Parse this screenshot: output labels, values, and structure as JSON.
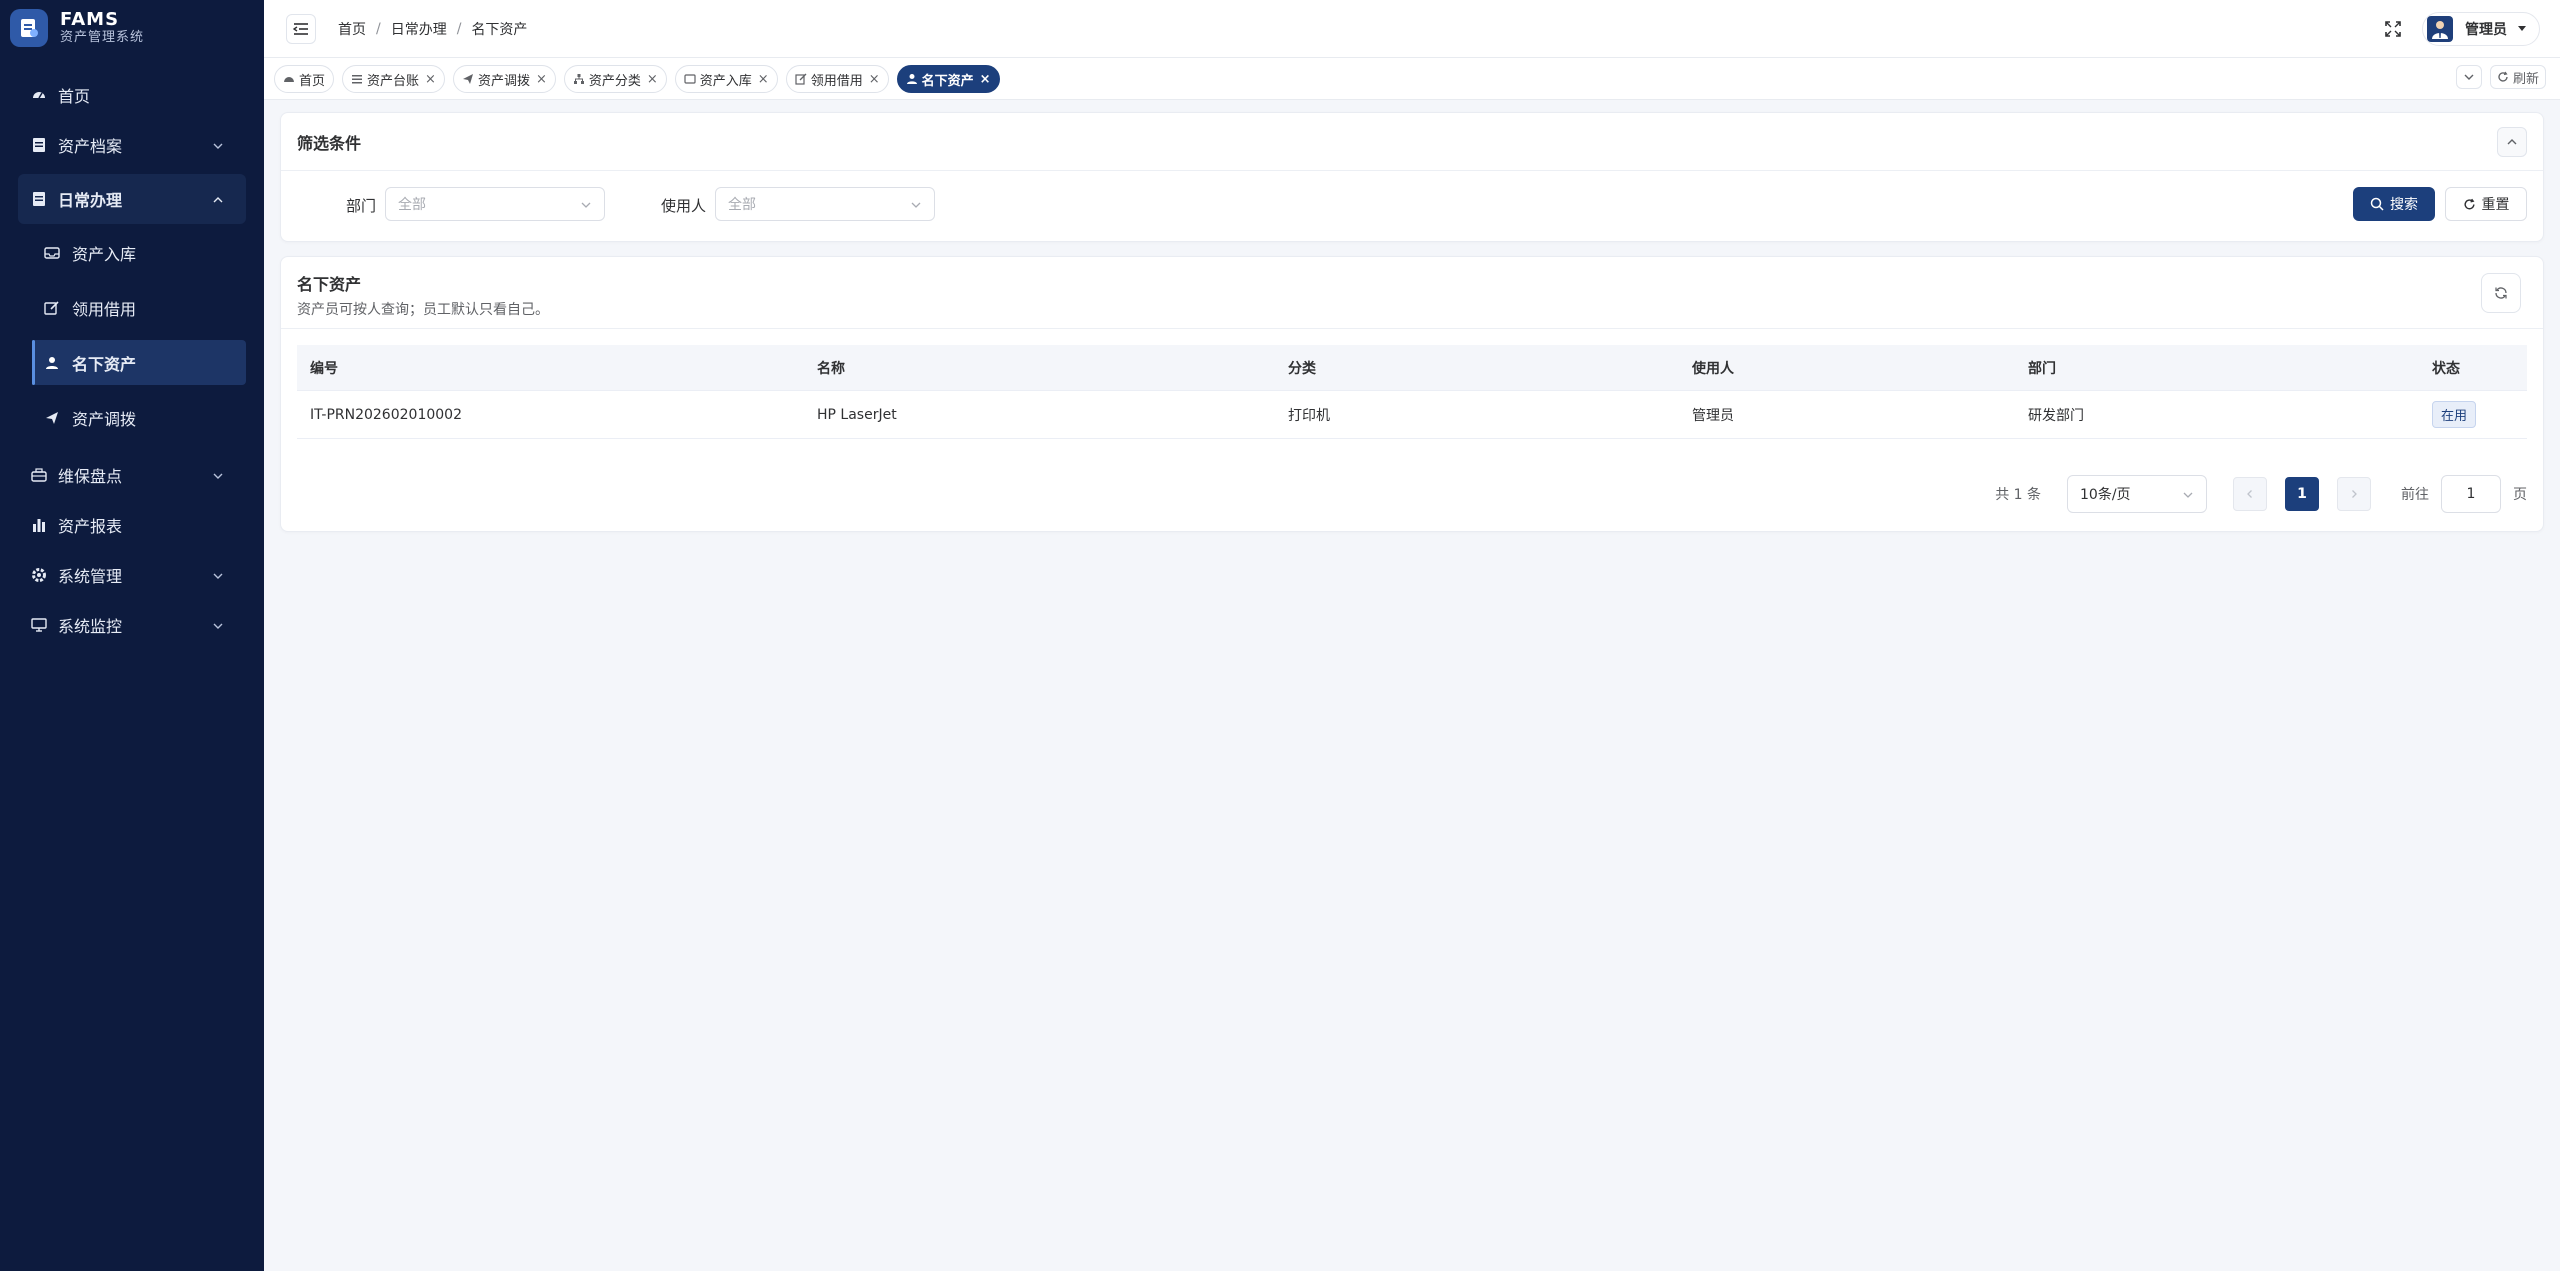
{
  "brand": {
    "name": "FAMS",
    "subtitle": "资产管理系统"
  },
  "sidebar": {
    "items": [
      {
        "label": "首页",
        "icon": "dashboard-icon"
      },
      {
        "label": "资产档案",
        "icon": "document-icon"
      },
      {
        "label": "日常办理",
        "icon": "document-icon",
        "expanded": true,
        "children": [
          {
            "label": "资产入库",
            "icon": "inbox-icon"
          },
          {
            "label": "领用借用",
            "icon": "edit-icon"
          },
          {
            "label": "名下资产",
            "icon": "user-icon",
            "active": true
          },
          {
            "label": "资产调拨",
            "icon": "send-icon"
          }
        ]
      },
      {
        "label": "维保盘点",
        "icon": "briefcase-icon"
      },
      {
        "label": "资产报表",
        "icon": "bar-chart-icon"
      },
      {
        "label": "系统管理",
        "icon": "gear-icon"
      },
      {
        "label": "系统监控",
        "icon": "monitor-icon"
      }
    ]
  },
  "header": {
    "breadcrumb": [
      "首页",
      "日常办理",
      "名下资产"
    ],
    "user": "管理员"
  },
  "tabs": [
    {
      "label": "首页",
      "closable": false
    },
    {
      "label": "资产台账",
      "closable": true
    },
    {
      "label": "资产调拨",
      "closable": true
    },
    {
      "label": "资产分类",
      "closable": true
    },
    {
      "label": "资产入库",
      "closable": true
    },
    {
      "label": "领用借用",
      "closable": true
    },
    {
      "label": "名下资产",
      "closable": true,
      "active": true
    }
  ],
  "tabs_refresh": "刷新",
  "filter": {
    "title": "筛选条件",
    "dept_label": "部门",
    "dept_value": "全部",
    "user_label": "使用人",
    "user_value": "全部",
    "search": "搜索",
    "reset": "重置"
  },
  "table": {
    "title": "名下资产",
    "subtitle": "资产员可按人查询；员工默认只看自己。",
    "columns": [
      "编号",
      "名称",
      "分类",
      "使用人",
      "部门",
      "状态"
    ],
    "rows": [
      [
        "IT-PRN202602010002",
        "HP LaserJet",
        "打印机",
        "管理员",
        "研发部门",
        "在用"
      ]
    ]
  },
  "pager": {
    "total": "共 1 条",
    "page_size": "10条/页",
    "current": "1",
    "goto_label": "前往",
    "goto_value": "1",
    "page_suffix": "页"
  },
  "colors": {
    "sidebar_bg": "#0d1b3e",
    "accent": "#1c3f7c"
  }
}
